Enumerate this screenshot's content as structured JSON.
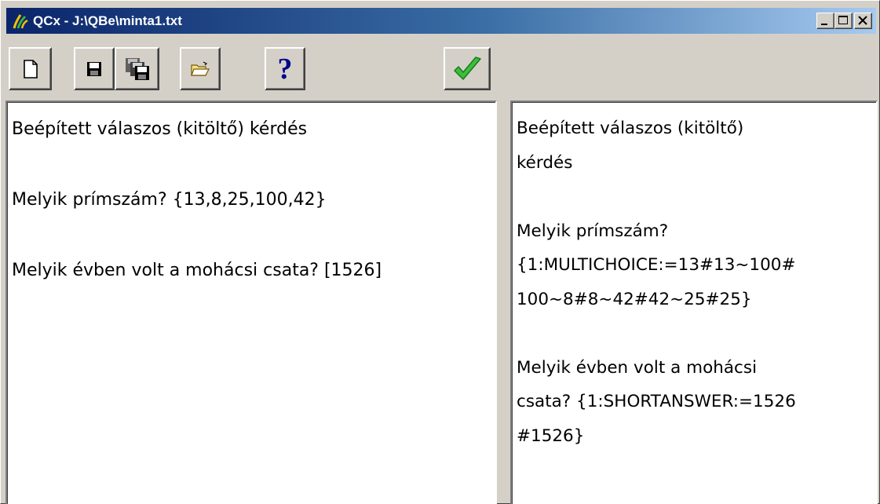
{
  "window": {
    "title": "QCx - J:\\QBe\\minta1.txt",
    "controls": {
      "minimize": "minimize",
      "maximize": "maximize",
      "close": "close"
    }
  },
  "toolbar": {
    "buttons": [
      {
        "name": "new-document",
        "icon": "new-document-icon"
      },
      {
        "name": "save",
        "icon": "floppy-disk-icon"
      },
      {
        "name": "save-all",
        "icon": "multiple-floppy-icon"
      },
      {
        "name": "open",
        "icon": "open-folder-icon"
      },
      {
        "name": "help",
        "icon": "question-mark-icon",
        "color": "#00008b"
      },
      {
        "name": "convert",
        "icon": "green-checkmark-icon",
        "color": "#2fa82f"
      }
    ],
    "help_label": "?"
  },
  "left_pane": {
    "text": "Beépített válaszos (kitöltő) kérdés\n\nMelyik prímszám? {13,8,25,100,42}\n\nMelyik évben volt a mohácsi csata? [1526]"
  },
  "right_pane": {
    "text": "Beépített válaszos (kitöltő)\nkérdés\n\nMelyik prímszám?\n{1:MULTICHOICE:=13#13~100#\n100~8#8~42#42~25#25}\n\nMelyik évben volt a mohácsi\ncsata? {1:SHORTANSWER:=1526\n#1526}"
  }
}
